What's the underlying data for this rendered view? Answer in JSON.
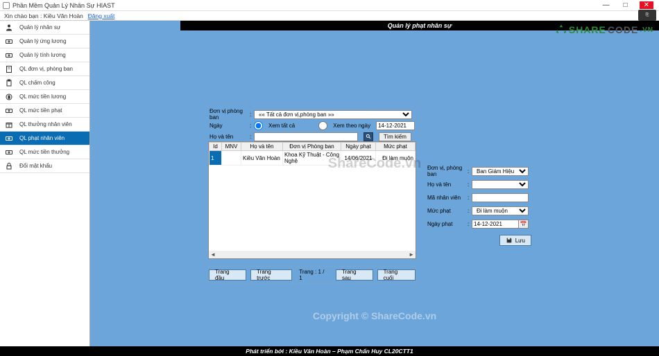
{
  "titlebar": {
    "title": "Phần Mềm Quản Lý Nhân Sự HIAST",
    "min": "—",
    "max": "□",
    "close": "✕"
  },
  "welcomebar": {
    "greeting": "Xin chào bạn : Kiều Văn Hoàn",
    "logout": "Đăng xuất"
  },
  "header": {
    "title": "Quản lý phạt nhân sự"
  },
  "sidebar": {
    "items": [
      {
        "label": "Quản lý nhân sự"
      },
      {
        "label": "Quản lý ứng lương"
      },
      {
        "label": "Quản lý tính lương"
      },
      {
        "label": "QL đơn vị, phòng ban"
      },
      {
        "label": "QL chấm công"
      },
      {
        "label": "QL mức tiền lương"
      },
      {
        "label": "QL mức tiền phạt"
      },
      {
        "label": "QL thưởng nhân viên"
      },
      {
        "label": "QL phạt nhân viên"
      },
      {
        "label": "QL mức tiền thưởng"
      },
      {
        "label": "Đổi mật khẩu"
      }
    ]
  },
  "filter": {
    "dept_label": "Đơn vị phòng ban",
    "dept_value": "«« Tất cả đơn vị,phòng ban »»",
    "date_label": "Ngày",
    "view_all": "Xem tất cả",
    "view_by_date": "Xem theo ngày",
    "date_input": "14-12-2021",
    "name_label": "Họ và tên",
    "name_value": "",
    "search_btn": "Tìm kiếm"
  },
  "table": {
    "headers": [
      "Id",
      "MNV",
      "Họ và tên",
      "Đơn vị Phòng ban",
      "Ngày phạt",
      "Mức phạt"
    ],
    "rows": [
      {
        "id": "1",
        "mnv": "",
        "name": "Kiều Văn Hoàn",
        "dept": "Khoa Kỹ Thuật - Công Nghệ",
        "date": "14/06/2021",
        "level": "Đi làm muộn"
      }
    ]
  },
  "pager": {
    "first": "Trang đầu",
    "prev": "Trang trước",
    "label": "Trang : 1 / 1",
    "next": "Trang sau",
    "last": "Trang cuối"
  },
  "rform": {
    "dept_label": "Đơn vị, phòng ban",
    "dept_value": "Ban Giám Hiệu",
    "name_label": "Họ và tên",
    "name_value": "",
    "emp_label": "Mã nhân viên",
    "emp_value": "",
    "level_label": "Mức phạt",
    "level_value": "Đi làm muộn",
    "date_label": "Ngày phạt",
    "date_value": "14-12-2021",
    "save": "Lưu"
  },
  "footer": {
    "text": "Phát triển bởi : Kiều Văn Hoàn – Phạm Chấn Huy CL20CTT1"
  },
  "watermarks": {
    "center": "ShareCode.vn",
    "copyright": "Copyright © ShareCode.vn",
    "logo_a": "SHARE",
    "logo_b": "CODE",
    "logo_c": ".VN"
  }
}
